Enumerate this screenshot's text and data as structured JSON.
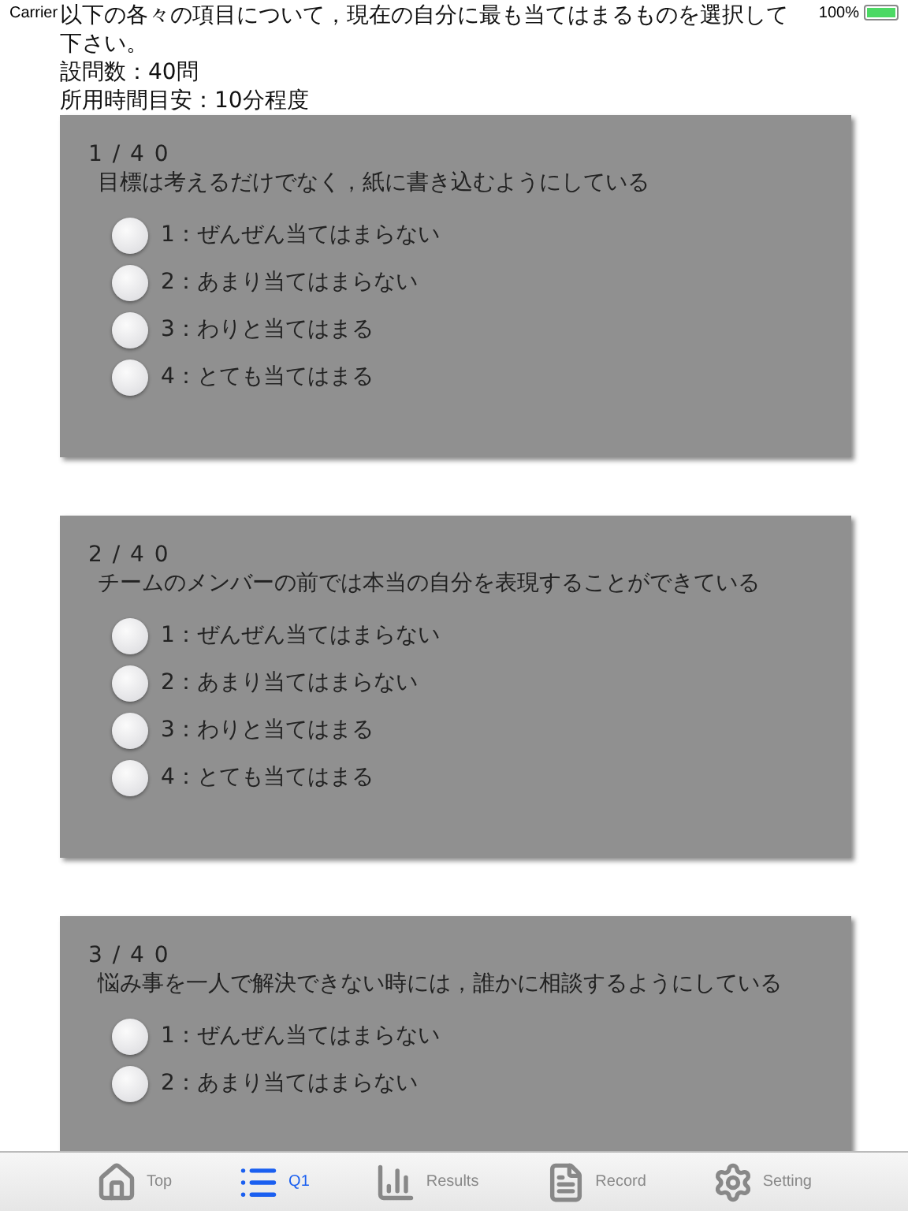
{
  "status_bar": {
    "carrier": "Carrier",
    "battery": "100%"
  },
  "intro": {
    "lines": [
      "以下の各々の項目について，現在の自分に最も当てはまるものを選択して",
      "下さい。",
      "設問数：40問",
      "所用時間目安：10分程度"
    ]
  },
  "questions": [
    {
      "number": "1 / 4 0",
      "text": "目標は考えるだけでなく，紙に書き込むようにしている",
      "options": [
        {
          "label": "1：ぜんぜん当てはまらない",
          "selected": false
        },
        {
          "label": "2：あまり当てはまらない",
          "selected": false
        },
        {
          "label": "3：わりと当てはまる",
          "selected": false
        },
        {
          "label": "4：とても当てはまる",
          "selected": false
        }
      ]
    },
    {
      "number": "2 / 4 0",
      "text": "チームのメンバーの前では本当の自分を表現することができている",
      "options": [
        {
          "label": "1：ぜんぜん当てはまらない",
          "selected": false
        },
        {
          "label": "2：あまり当てはまらない",
          "selected": false
        },
        {
          "label": "3：わりと当てはまる",
          "selected": false
        },
        {
          "label": "4：とても当てはまる",
          "selected": false
        }
      ]
    },
    {
      "number": "3 / 4 0",
      "text": "悩み事を一人で解決できない時には，誰かに相談するようにしている",
      "options": [
        {
          "label": "1：ぜんぜん当てはまらない",
          "selected": false
        },
        {
          "label": "2：あまり当てはまらない",
          "selected": false
        }
      ]
    }
  ],
  "tab_bar": [
    {
      "kind": "home",
      "label": "Top",
      "selected": false
    },
    {
      "kind": "list",
      "label": "Q1",
      "selected": true
    },
    {
      "kind": "chart",
      "label": "Results",
      "selected": false
    },
    {
      "kind": "document",
      "label": "Record",
      "selected": false
    },
    {
      "kind": "gear",
      "label": "Setting",
      "selected": false
    }
  ]
}
